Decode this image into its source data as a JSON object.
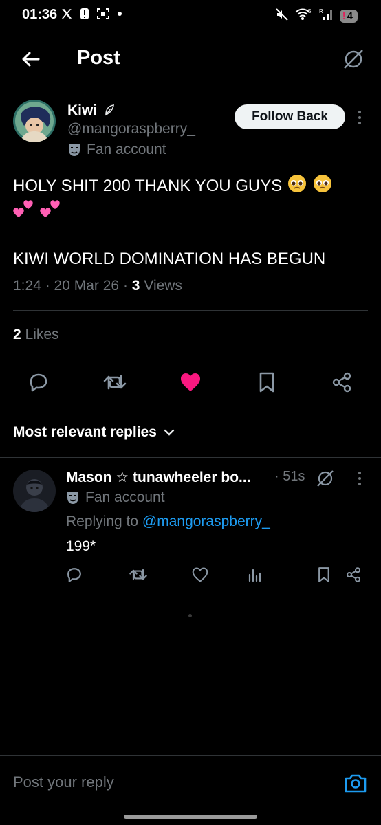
{
  "status": {
    "time": "01:36",
    "network": "5",
    "roaming": "R",
    "battery_alert": "!",
    "battery": "4"
  },
  "header": {
    "title": "Post"
  },
  "post": {
    "author_name": "Kiwi",
    "author_handle": "@mangoraspberry_",
    "label": "Fan account",
    "follow_label": "Follow Back",
    "text_line1": "HOLY SHIT 200 THANK YOU GUYS",
    "text_line3": "KIWI WORLD DOMINATION HAS BEGUN",
    "time": "1:24",
    "date": "20 Mar 26",
    "views_count": "3",
    "views_label": "Views",
    "likes_count": "2",
    "likes_label": "Likes"
  },
  "replies_header": {
    "label": "Most relevant replies"
  },
  "reply": {
    "author_name": "Mason ☆ tunawheeler bo...",
    "time": "51s",
    "label": "Fan account",
    "replying_prefix": "Replying to",
    "replying_handle": "@mangoraspberry_",
    "text": "199*"
  },
  "composer": {
    "placeholder": "Post your reply"
  },
  "colors": {
    "accent": "#1d9bf0",
    "like": "#f91880",
    "muted": "#71767b",
    "divider": "#2f3336"
  }
}
